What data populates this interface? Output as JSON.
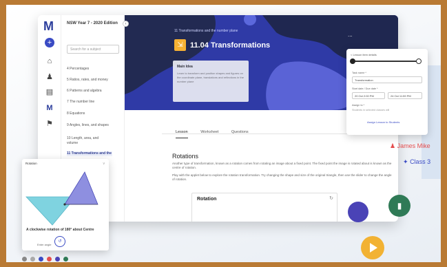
{
  "app": {
    "logo": "M",
    "edition_title": "NSW Year 7 - 2020 Edition",
    "search_placeholder": "Search for a subject",
    "collapse_glyph": "‹"
  },
  "rail": {
    "icons": [
      "plus-icon",
      "bank-icon",
      "person-icon",
      "document-icon",
      "book-icon",
      "flag-icon"
    ]
  },
  "sidebar": {
    "items": [
      "4 Percentages",
      "5 Ratios, rates, and money",
      "6 Patterns and algebra",
      "7 The number line",
      "8 Equations",
      "9 Angles, lines, and shapes",
      "10 Length, area, and volume",
      "11 Transformations and the"
    ]
  },
  "hero": {
    "breadcrumb": "11 Transformations and the number plane",
    "title": "11.04 Transformations",
    "menu": "...",
    "info_heading": "Main Idea",
    "info_text": "Learn to transform and position shapes and figures on the coordinate plane, translations and reflections in the number plane"
  },
  "tabs": [
    "Lesson",
    "Worksheet",
    "Questions"
  ],
  "lesson": {
    "section_title": "Rotations",
    "para1": "Another type of transformation, known as a rotation comes from rotating an image about a fixed point. The fixed point the image is rotated about is known as the centre of rotation.",
    "para2": "Play with the applet below to explore the rotation transformation. Try changing the shape and size of the original triangle, then use the slider to change the angle of rotation.",
    "applet_title": "Rotation",
    "refresh_glyph": "↻"
  },
  "assign": {
    "header": "< Lesson item details",
    "task_name_label": "Task name *",
    "task_name_value": "Transformation",
    "dates_label": "Start date / Due date *",
    "start_date": "20 Oct 2:00 PM",
    "due_date": "24 Oct 11:59 PM",
    "assign_label": "Assign to *",
    "assign_hint": "Students in selected classes will",
    "button": "Assign Lesson to Students"
  },
  "chips": {
    "student": "James Mike",
    "class": "Class 3",
    "student_glyph": "♟",
    "class_glyph": "✦"
  },
  "rotation_card": {
    "title": "Rotation",
    "version": "v",
    "caption": "A clockwise rotation of 180° about Centre",
    "angle_label": "Enter angle",
    "dial_glyph": "↺"
  },
  "colors": {
    "hero_bg": "#2f3aa6",
    "accent": "#3a4bc4",
    "title_icon": "#f7b233",
    "student_chip": "#e44d4d",
    "green": "#2f7a56",
    "yellow": "#f2b233"
  }
}
